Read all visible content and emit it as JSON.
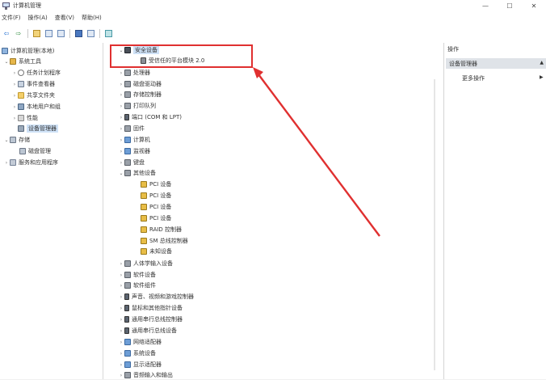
{
  "window": {
    "title": "计算机管理",
    "controls": {
      "minimize": "—",
      "maximize": "☐",
      "close": "✕"
    }
  },
  "menubar": {
    "items": [
      "文件(F)",
      "操作(A)",
      "查看(V)",
      "帮助(H)"
    ]
  },
  "toolbar": {
    "back_glyph": "⇦",
    "forward_glyph": "⇨"
  },
  "left_tree": {
    "root": {
      "label": "计算机管理(本地)",
      "icon": "monitor-icon"
    },
    "system_tools": {
      "label": "系统工具",
      "icon": "tools-icon"
    },
    "task_scheduler": {
      "label": "任务计划程序",
      "icon": "clock-icon"
    },
    "event_viewer": {
      "label": "事件查看器",
      "icon": "event-viewer-icon"
    },
    "shared_folders": {
      "label": "共享文件夹",
      "icon": "folder-icon"
    },
    "local_users": {
      "label": "本地用户和组",
      "icon": "users-icon"
    },
    "performance": {
      "label": "性能",
      "icon": "performance-icon"
    },
    "device_manager": {
      "label": "设备管理器",
      "icon": "device-manager-icon"
    },
    "storage": {
      "label": "存储",
      "icon": "storage-icon"
    },
    "disk_management": {
      "label": "磁盘管理",
      "icon": "disk-icon"
    },
    "services_apps": {
      "label": "服务和应用程序",
      "icon": "services-icon"
    }
  },
  "device_tree": {
    "security_devices": {
      "label": "安全设备",
      "child": "受信任的平台模块 2.0"
    },
    "categories_before_other": [
      "处理器",
      "磁盘驱动器",
      "存储控制器",
      "打印队列",
      "端口 (COM 和 LPT)",
      "固件",
      "计算机",
      "监视器",
      "键盘"
    ],
    "other_devices": {
      "label": "其他设备",
      "children": [
        "PCI 设备",
        "PCI 设备",
        "PCI 设备",
        "PCI 设备",
        "RAID 控制器",
        "SM 总线控制器",
        "未知设备"
      ]
    },
    "categories_after_other": [
      "人体学输入设备",
      "软件设备",
      "软件组件",
      "声音、视频和游戏控制器",
      "鼠标和其他指针设备",
      "通用串行总线控制器",
      "通用串行总线设备",
      "网络适配器",
      "系统设备",
      "显示适配器",
      "音频输入和输出"
    ]
  },
  "actions_pane": {
    "header": "操作",
    "section": "设备管理器",
    "more": "更多操作"
  },
  "annotation": {
    "color": "#e03030"
  }
}
